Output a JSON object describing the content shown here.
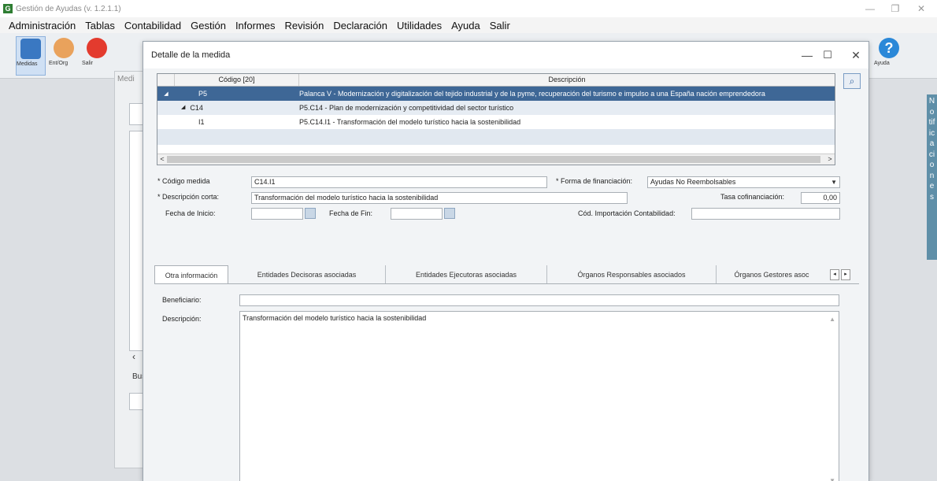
{
  "app": {
    "title": "Gestión de Ayudas (v. 1.2.1.1)",
    "icon_letter": "G",
    "window_controls": [
      "—",
      "❐",
      "✕"
    ]
  },
  "menu": [
    "Administración",
    "Tablas",
    "Contabilidad",
    "Gestión",
    "Informes",
    "Revisión",
    "Declaración",
    "Utilidades",
    "Ayuda",
    "Salir"
  ],
  "toolbar": {
    "medidas": "Medidas",
    "ent_org": "Ent/Org",
    "salir": "Salir",
    "ayuda": "Ayuda"
  },
  "background_panel": {
    "title": "Medi",
    "busc": "Bus",
    "arrow": "‹"
  },
  "notifications_tab": "Notificaciones",
  "dialog": {
    "title": "Detalle de la medida",
    "controls": [
      "—",
      "☐",
      "✕"
    ],
    "grid": {
      "headers": {
        "code": "Código [20]",
        "desc": "Descripción"
      },
      "rows": [
        {
          "marker": "◢",
          "code": "P5",
          "desc": "Palanca V - Modernización y digitalización del tejido industrial y de la pyme, recuperación del turismo e impulso a una España nación emprendedora"
        },
        {
          "marker": "◢",
          "code": "C14",
          "desc": "P5.C14 - Plan de modernización y competitividad del sector turístico"
        },
        {
          "marker": "",
          "code": "I1",
          "desc": "P5.C14.I1 - Transformación del modelo turístico hacia la sostenibilidad"
        }
      ],
      "scroll_left": "<",
      "scroll_right": ">"
    },
    "search_icon": "search-icon",
    "fields": {
      "codigo_medida_label": "* Código medida",
      "codigo_medida_value": "C14.I1",
      "forma_financiacion_label": "* Forma de financiación:",
      "forma_financiacion_value": "Ayudas No Reembolsables",
      "descripcion_corta_label": "* Descripción corta:",
      "descripcion_corta_value": "Transformación del modelo turístico hacia la sostenibilidad",
      "tasa_label": "Tasa cofinanciación:",
      "tasa_value": "0,00",
      "fecha_inicio_label": "Fecha de Inicio:",
      "fecha_inicio_value": "",
      "fecha_fin_label": "Fecha de Fin:",
      "fecha_fin_value": "",
      "cod_importacion_label": "Cód. Importación Contabilidad:",
      "cod_importacion_value": ""
    },
    "tabs": [
      "Otra información",
      "Entidades Decisoras asociadas",
      "Entidades Ejecutoras asociadas",
      "Órganos Responsables asociados",
      "Órganos Gestores asoc"
    ],
    "tab_scroll": [
      "◂",
      "▸"
    ],
    "other_info": {
      "beneficiario_label": "Beneficiario:",
      "beneficiario_value": "",
      "descripcion_label": "Descripción:",
      "descripcion_value": "Transformación del modelo turístico hacia la sostenibilidad"
    }
  }
}
